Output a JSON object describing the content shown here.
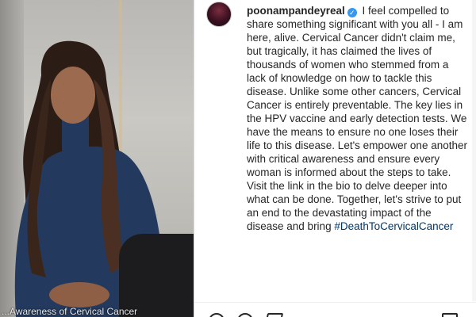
{
  "media": {
    "caption_text": "...Awareness of Cervical Cancer"
  },
  "post": {
    "username": "poonampandeyreal",
    "verified": true,
    "caption": "I feel compelled to share something significant with you all - I am here, alive. Cervical Cancer didn't claim me, but tragically, it has claimed the lives of thousands of women who stemmed from a lack of knowledge on how to tackle this disease. Unlike some other cancers, Cervical Cancer is entirely preventable. The key lies in the HPV vaccine and early detection tests. We have the means to ensure no one loses their life to this disease. Let's empower one another with critical awareness and ensure every woman is informed about the steps to take. Visit the link in the bio to delve deeper into what can be done. Together, let's strive to put an end to the devastating impact of the disease and bring",
    "hashtag": "#DeathToCervicalCancer"
  },
  "icons": {
    "verified": "verified-badge-icon",
    "like": "heart-icon",
    "comment": "comment-icon",
    "share": "share-icon",
    "save": "bookmark-icon"
  },
  "colors": {
    "verified_blue": "#3897f0",
    "hashtag": "#00376b",
    "text": "#262626"
  }
}
